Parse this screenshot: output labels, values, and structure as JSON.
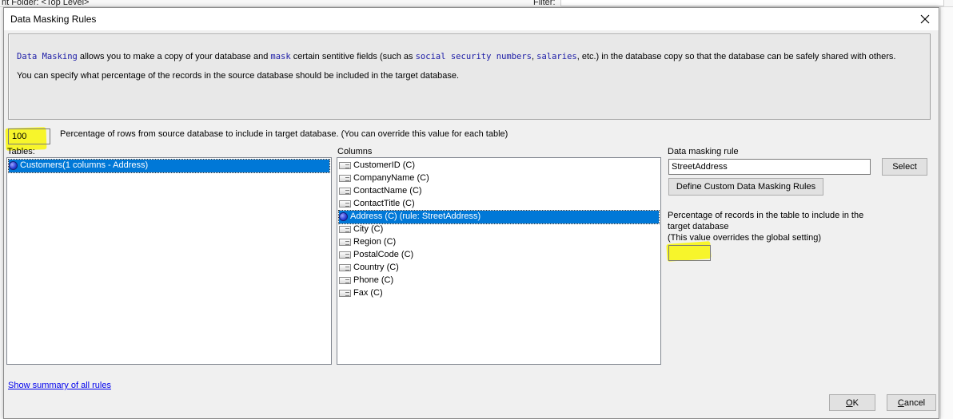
{
  "background": {
    "folder_label": "nt Folder: <Top Level>",
    "filter_label": "Filter:"
  },
  "dialog": {
    "title": "Data Masking Rules",
    "close_icon": "close-icon"
  },
  "description": {
    "line1": {
      "kw_data_masking": "Data Masking",
      "t1": " allows you to make a copy of your database and ",
      "kw_mask": "mask",
      "t2": " certain sentitive fields (such as ",
      "kw_ssn": "social security numbers",
      "t3": ", ",
      "kw_salaries": "salaries",
      "t4": ", etc.) in the database copy so that the database can be safely shared with others."
    },
    "line2": "You can specify what percentage of the records in the source database should be included in the target database."
  },
  "global_percentage": {
    "value": "100",
    "label": "Percentage of rows from source database to include in target database. (You can override this value for each table)"
  },
  "tables": {
    "label": "Tables:",
    "items": [
      {
        "label": "Customers(1 columns - Address)",
        "selected": true,
        "icon": "bullet-icon"
      }
    ]
  },
  "columns": {
    "label": "Columns",
    "items": [
      {
        "label": "CustomerID (C)",
        "selected": false,
        "icon": "field-icon"
      },
      {
        "label": "CompanyName (C)",
        "selected": false,
        "icon": "field-icon"
      },
      {
        "label": "ContactName (C)",
        "selected": false,
        "icon": "field-icon"
      },
      {
        "label": "ContactTitle (C)",
        "selected": false,
        "icon": "field-icon"
      },
      {
        "label": "Address (C) (rule: StreetAddress)",
        "selected": true,
        "icon": "bullet-icon"
      },
      {
        "label": "City (C)",
        "selected": false,
        "icon": "field-icon"
      },
      {
        "label": "Region (C)",
        "selected": false,
        "icon": "field-icon"
      },
      {
        "label": "PostalCode (C)",
        "selected": false,
        "icon": "field-icon"
      },
      {
        "label": "Country (C)",
        "selected": false,
        "icon": "field-icon"
      },
      {
        "label": "Phone (C)",
        "selected": false,
        "icon": "field-icon"
      },
      {
        "label": "Fax (C)",
        "selected": false,
        "icon": "field-icon"
      }
    ]
  },
  "masking_rule": {
    "label": "Data masking rule",
    "value": "StreetAddress",
    "select_label": "Select",
    "define_custom_label": "Define Custom Data Masking Rules"
  },
  "table_percentage": {
    "label_line1": "Percentage of records in the table to include in the",
    "label_line2": "target database",
    "label_line3": "(This value overrides the global setting)",
    "value": ""
  },
  "footer": {
    "summary_link": "Show summary of all rules",
    "ok_label": "OK",
    "cancel_label": "Cancel"
  },
  "colors": {
    "highlight": "#f7f52b",
    "selection": "#0078d7",
    "keyword": "#1a1aa6"
  }
}
